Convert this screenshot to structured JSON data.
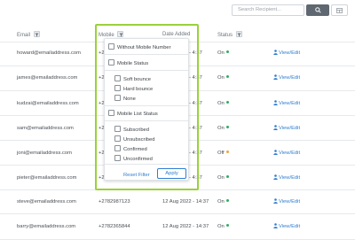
{
  "search": {
    "placeholder": "Search Recipient..."
  },
  "columns": {
    "email": "Email",
    "mobile": "Mobile",
    "date_added": "Date Added",
    "status": "Status"
  },
  "rows": [
    {
      "email": "howard@emailaddress.com",
      "mobile": "+2",
      "date": "- 4:37",
      "status": "On",
      "status_color": "#2fae5f",
      "action": "View/Edit"
    },
    {
      "email": "james@emailaddress.com",
      "mobile": "+2",
      "date": "- 4:37",
      "status": "On",
      "status_color": "#2fae5f",
      "action": "View/Edit"
    },
    {
      "email": "kudzai@emailaddress.com",
      "mobile": "+2",
      "date": "- 4:37",
      "status": "On",
      "status_color": "#2fae5f",
      "action": "View/Edit"
    },
    {
      "email": "sam@emailaddress.com",
      "mobile": "+2",
      "date": "- 4:37",
      "status": "On",
      "status_color": "#2fae5f",
      "action": "View/Edit"
    },
    {
      "email": "joni@emailaddress.com",
      "mobile": "+2",
      "date": "- 4:37",
      "status": "Off",
      "status_color": "#f0a43a",
      "action": "View/Edit"
    },
    {
      "email": "pieter@emailaddress.com",
      "mobile": "+2",
      "date": "- 4:37",
      "status": "On",
      "status_color": "#2fae5f",
      "action": "View/Edit"
    },
    {
      "email": "steve@emailaddress.com",
      "mobile": "+2782987123",
      "date": "12 Aug 2022 - 14:37",
      "status": "On",
      "status_color": "#2fae5f",
      "action": "View/Edit"
    },
    {
      "email": "barry@emailaddress.com",
      "mobile": "+2782365844",
      "date": "12 Aug 2022 - 14:37",
      "status": "On",
      "status_color": "#2fae5f",
      "action": "View/Edit"
    }
  ],
  "filter_dropdown": {
    "without_mobile": "Without Mobile Number",
    "mobile_status": "Mobile Status",
    "soft_bounce": "Soft bounce",
    "hard_bounce": "Hard bounce",
    "none": "None",
    "mobile_list_status": "Mobile List Status",
    "subscribed": "Subscribed",
    "unsubscribed": "Unsubscribed",
    "confirmed": "Confirmed",
    "unconfirmed": "Unconfirmed",
    "reset": "Reset Filter",
    "apply": "Apply"
  },
  "colors": {
    "accent": "#2f7dd1",
    "highlight": "#9ad13b",
    "status_on": "#2fae5f",
    "status_off": "#f0a43a"
  }
}
